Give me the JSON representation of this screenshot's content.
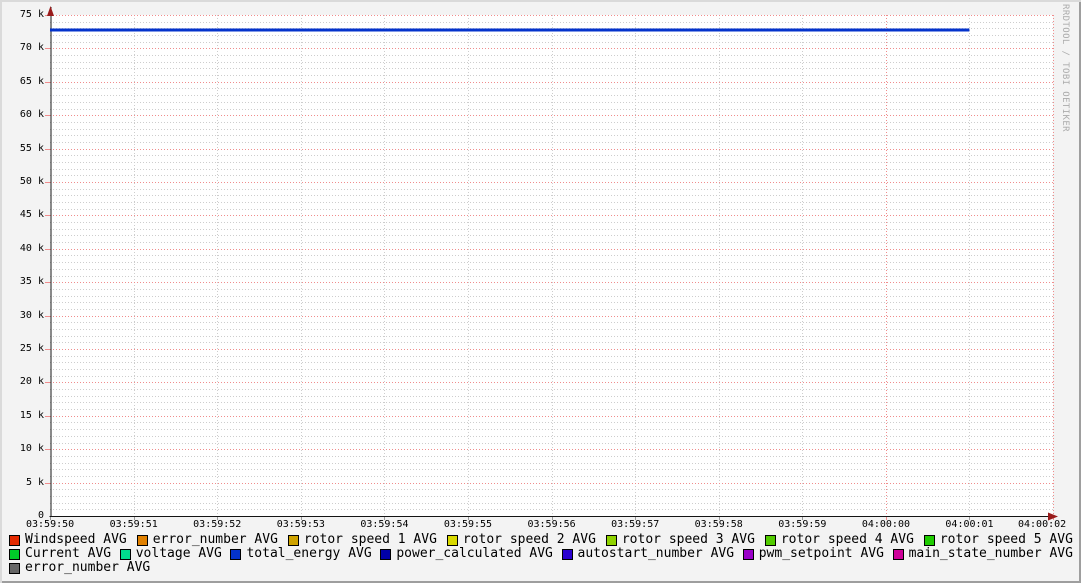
{
  "watermark": "RRDTOOL / TOBI OETIKER",
  "colors": {
    "back": "#F3F3F3",
    "canvas": "#FFFFFF",
    "grid_minor": "#CDCDCD",
    "grid_major": "#F08C8C",
    "axis": "#141414",
    "arrow": "#991B1B",
    "tick": "#999999",
    "text": "#000000",
    "watermark_color": "#ABABAB",
    "frame_light": "#DADADA",
    "frame_dark": "#9E9E9E"
  },
  "chart_data": {
    "type": "line",
    "title": "",
    "xlabel": "",
    "ylabel": "",
    "grid": true,
    "legend_position": "bottom",
    "ylim": [
      0,
      75000
    ],
    "y_major_step": 5000,
    "y_minor_step": 1000,
    "y_tick_labels": [
      "0",
      "5 k",
      "10 k",
      "15 k",
      "20 k",
      "25 k",
      "30 k",
      "35 k",
      "40 k",
      "45 k",
      "50 k",
      "55 k",
      "60 k",
      "65 k",
      "70 k",
      "75 k"
    ],
    "x_tick_labels": [
      "03:59:50",
      "03:59:51",
      "03:59:52",
      "03:59:53",
      "03:59:54",
      "03:59:55",
      "03:59:56",
      "03:59:57",
      "03:59:58",
      "03:59:59",
      "04:00:00",
      "04:00:01",
      "04:00:02"
    ],
    "x_red_gridlines": [
      "04:00:00",
      "04:00:02"
    ],
    "series": [
      {
        "name": "total_energy AVG",
        "color": "#0433CC",
        "line_width": 3,
        "x": [
          "03:59:50",
          "03:59:51",
          "03:59:52",
          "03:59:53",
          "03:59:54",
          "03:59:55",
          "03:59:56",
          "03:59:57",
          "03:59:58",
          "03:59:59",
          "04:00:00",
          "04:00:01"
        ],
        "values": [
          72800,
          72800,
          72800,
          72800,
          72800,
          72800,
          72800,
          72800,
          72800,
          72800,
          72800,
          72800
        ]
      }
    ]
  },
  "legend": {
    "rows": [
      [
        {
          "label": "Windspeed AVG",
          "color": "#E42A00"
        },
        {
          "label": "error_number AVG",
          "color": "#E08000"
        },
        {
          "label": "rotor speed 1 AVG",
          "color": "#CFA300"
        },
        {
          "label": "rotor speed 2 AVG",
          "color": "#D9D900"
        },
        {
          "label": "rotor speed 3 AVG",
          "color": "#8FD200"
        },
        {
          "label": "rotor speed 4 AVG",
          "color": "#52CB00"
        },
        {
          "label": "rotor speed 5 AVG",
          "color": "#1FCC00"
        }
      ],
      [
        {
          "label": "Current AVG",
          "color": "#00CC29"
        },
        {
          "label": "voltage AVG",
          "color": "#00DD8D"
        },
        {
          "label": "total_energy AVG",
          "color": "#0433CC"
        },
        {
          "label": "power_calculated AVG",
          "color": "#0000A6"
        },
        {
          "label": "autostart_number AVG",
          "color": "#2A00D0"
        },
        {
          "label": "pwm_setpoint AVG",
          "color": "#9A00C8"
        },
        {
          "label": "main_state_number AVG",
          "color": "#CE0099"
        }
      ],
      [
        {
          "label": "error_number AVG",
          "color": "#666666"
        }
      ]
    ]
  }
}
